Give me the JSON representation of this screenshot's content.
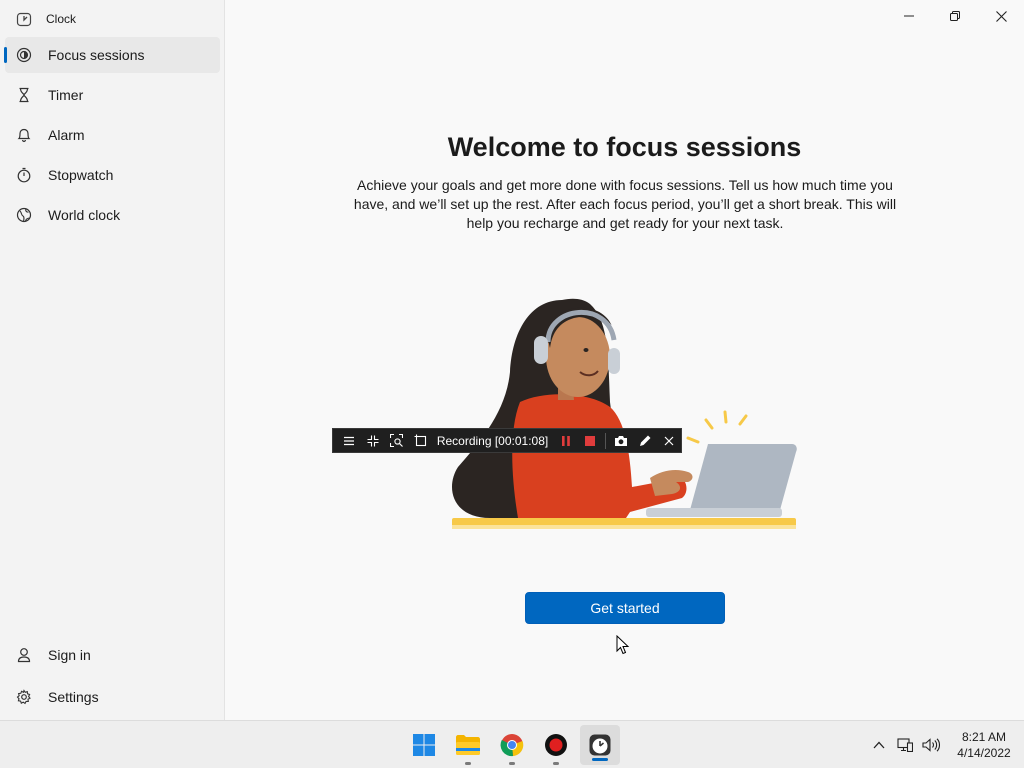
{
  "app": {
    "title": "Clock"
  },
  "sidebar": {
    "items": [
      {
        "label": "Focus sessions",
        "icon": "focus-icon",
        "selected": true
      },
      {
        "label": "Timer",
        "icon": "hourglass-icon"
      },
      {
        "label": "Alarm",
        "icon": "bell-icon"
      },
      {
        "label": "Stopwatch",
        "icon": "stopwatch-icon"
      },
      {
        "label": "World clock",
        "icon": "globe-icon"
      }
    ],
    "bottom": [
      {
        "label": "Sign in",
        "icon": "person-icon"
      },
      {
        "label": "Settings",
        "icon": "gear-icon"
      }
    ]
  },
  "main": {
    "headline": "Welcome to focus sessions",
    "description": "Achieve your goals and get more done with focus sessions. Tell us how much time you have, and we’ll set up the rest. After each focus period, you’ll get a short break. This will help you recharge and get ready for your next task.",
    "cta": "Get started"
  },
  "recording_toolbar": {
    "label": "Recording [00:01:08]"
  },
  "taskbar": {
    "apps": [
      "start-icon",
      "file-explorer-icon",
      "chrome-icon",
      "recorder-icon",
      "clock-app-icon"
    ],
    "time": "8:21 AM",
    "date": "4/14/2022"
  },
  "colors": {
    "accent": "#0067c0",
    "shirt": "#d9401f",
    "recording_red": "#e03c3c",
    "desk": "#f7c948"
  }
}
